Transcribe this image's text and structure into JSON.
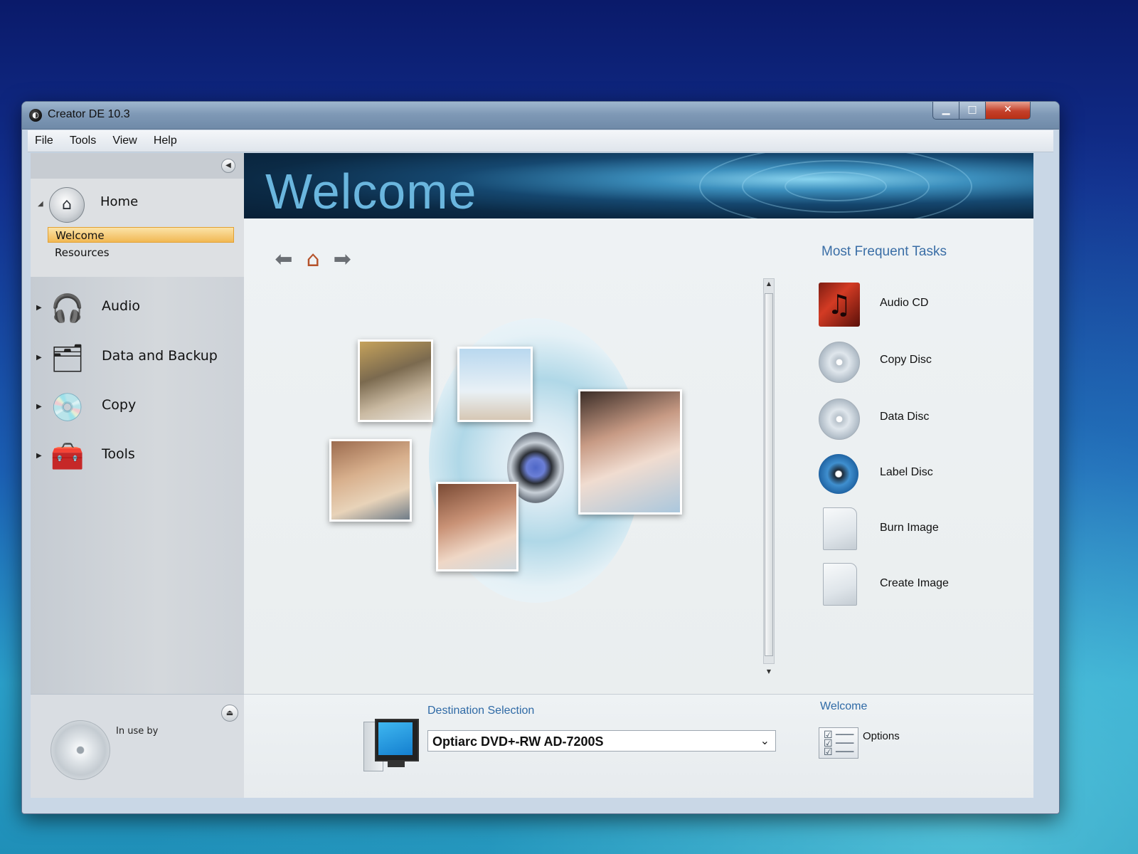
{
  "window": {
    "title": "Creator DE 10.3"
  },
  "menu": {
    "file": "File",
    "tools": "Tools",
    "view": "View",
    "help": "Help"
  },
  "sidebar": {
    "home": {
      "label": "Home",
      "sub": {
        "welcome": "Welcome",
        "resources": "Resources"
      }
    },
    "items": [
      {
        "label": "Audio",
        "icon": "headphones-icon"
      },
      {
        "label": "Data and Backup",
        "icon": "data-backup-icon"
      },
      {
        "label": "Copy",
        "icon": "copy-discs-icon"
      },
      {
        "label": "Tools",
        "icon": "toolbox-icon"
      }
    ],
    "footer": {
      "in_use_label": "In use by"
    }
  },
  "banner": {
    "title": "Welcome"
  },
  "tasks": {
    "title": "Most Frequent Tasks",
    "items": [
      {
        "label": "Audio CD",
        "icon": "audio-cd-icon"
      },
      {
        "label": "Copy Disc",
        "icon": "copy-disc-icon"
      },
      {
        "label": "Data Disc",
        "icon": "data-disc-icon"
      },
      {
        "label": "Label Disc",
        "icon": "label-disc-icon"
      },
      {
        "label": "Burn Image",
        "icon": "burn-image-icon"
      },
      {
        "label": "Create Image",
        "icon": "create-image-icon"
      }
    ]
  },
  "destination": {
    "title": "Destination Selection",
    "selected": "Optiarc DVD+-RW AD-7200S"
  },
  "bottom_welcome": {
    "title": "Welcome",
    "options_label": "Options"
  },
  "colors": {
    "accent_blue": "#3a6ea6",
    "selected_item": "#f1b854",
    "close_button": "#c4402a"
  }
}
